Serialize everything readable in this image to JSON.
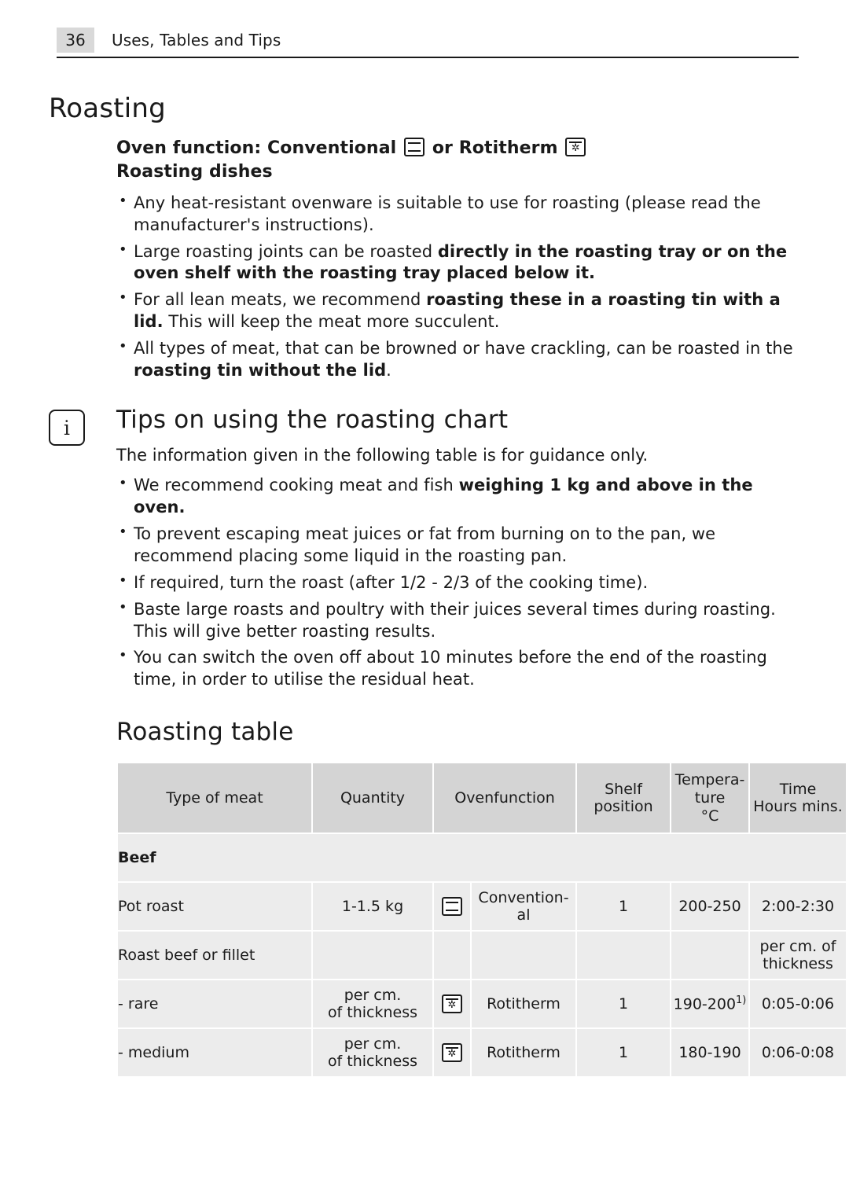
{
  "header": {
    "page_number": "36",
    "title": "Uses, Tables and Tips"
  },
  "roasting": {
    "title": "Roasting",
    "oven_function_prefix": "Oven function: Conventional",
    "oven_function_middle": "or Rotitherm",
    "dishes_heading": "Roasting dishes",
    "bullets": [
      {
        "parts": [
          {
            "text": "Any heat-resistant ovenware is suitable to use for roasting (please read the manufacturer's instructions).",
            "bold": false
          }
        ]
      },
      {
        "parts": [
          {
            "text": "Large roasting joints can be roasted ",
            "bold": false
          },
          {
            "text": "directly in the roasting tray or on the oven shelf with the roasting tray placed below it.",
            "bold": true
          }
        ]
      },
      {
        "parts": [
          {
            "text": "For all lean meats, we recommend ",
            "bold": false
          },
          {
            "text": "roasting these in a roasting tin with a lid.",
            "bold": true
          },
          {
            "text": " This will keep the meat more succulent.",
            "bold": false
          }
        ]
      },
      {
        "parts": [
          {
            "text": "All types of meat, that can be browned or have crackling, can be roasted in the ",
            "bold": false
          },
          {
            "text": "roasting tin without the lid",
            "bold": true
          },
          {
            "text": ".",
            "bold": false
          }
        ]
      }
    ]
  },
  "tips": {
    "icon": "info-icon",
    "icon_glyph": "i",
    "title": "Tips on using the roasting chart",
    "intro": "The information given in the following table is for guidance only.",
    "bullets": [
      {
        "parts": [
          {
            "text": "We recommend cooking meat and fish ",
            "bold": false
          },
          {
            "text": "weighing 1 kg and above in the oven.",
            "bold": true
          }
        ]
      },
      {
        "parts": [
          {
            "text": "To prevent escaping meat juices or fat from burning on to the pan, we recommend placing some liquid in the roasting pan.",
            "bold": false
          }
        ]
      },
      {
        "parts": [
          {
            "text": "If required, turn the roast (after 1/2 - 2/3 of the cooking time).",
            "bold": false
          }
        ]
      },
      {
        "parts": [
          {
            "text": "Baste large roasts and poultry with their juices several times during roasting. This will give better roasting results.",
            "bold": false
          }
        ]
      },
      {
        "parts": [
          {
            "text": "You can switch the oven off about 10 minutes before the end of the roasting time, in order to utilise the residual heat.",
            "bold": false
          }
        ]
      }
    ]
  },
  "table": {
    "title": "Roasting table",
    "columns": [
      {
        "label": "Type of meat"
      },
      {
        "label": "Quantity"
      },
      {
        "label": "Ovenfunction"
      },
      {
        "label": "Shelf\nposition"
      },
      {
        "label": "Tempera-\nture\n°C"
      },
      {
        "label": "Time\nHours mins."
      }
    ],
    "groups": [
      {
        "name": "Beef",
        "rows": [
          {
            "type": "Pot roast",
            "quantity": "1-1.5 kg",
            "icon": "conventional",
            "ovenfunction": "Convention-\nal",
            "shelf": "1",
            "temperature": "200-250",
            "time": "2:00-2:30"
          },
          {
            "type": "Roast beef or fillet",
            "quantity": "",
            "icon": "",
            "ovenfunction": "",
            "shelf": "",
            "temperature": "",
            "time": "per cm. of\nthickness"
          },
          {
            "type": "- rare",
            "quantity": "per cm.\nof thickness",
            "icon": "rotitherm",
            "ovenfunction": "Rotitherm",
            "shelf": "1",
            "temperature": "190-200",
            "temperature_note": "1)",
            "time": "0:05-0:06"
          },
          {
            "type": "- medium",
            "quantity": "per cm.\nof thickness",
            "icon": "rotitherm",
            "ovenfunction": "Rotitherm",
            "shelf": "1",
            "temperature": "180-190",
            "time": "0:06-0:08"
          }
        ]
      }
    ]
  }
}
